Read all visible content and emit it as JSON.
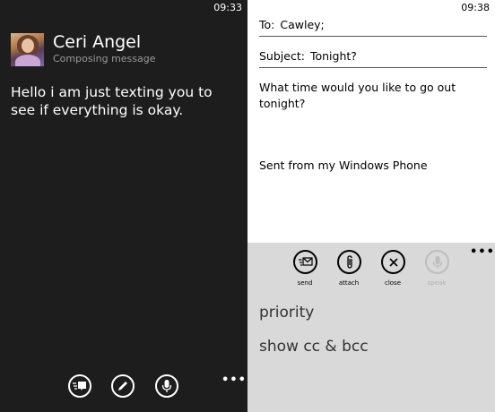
{
  "left_phone": {
    "status_time": "09:33",
    "contact": {
      "name": "Ceri Angel",
      "status": "Composing message"
    },
    "message": "Hello i am just texting you to see if everything is okay.",
    "appbar": {
      "icons": [
        "send-sms-icon",
        "edit-icon",
        "microphone-icon"
      ],
      "more": "•••"
    }
  },
  "right_phone": {
    "status_time": "09:38",
    "to": {
      "label": "To:",
      "value": "Cawley;"
    },
    "subject": {
      "label": "Subject:",
      "value": "Tonight?"
    },
    "body_line1": "What time would you like to go out tonight?",
    "signature": "Sent from my Windows Phone",
    "appbar": {
      "buttons": [
        {
          "label": "send",
          "icon": "send-mail-icon"
        },
        {
          "label": "attach",
          "icon": "paperclip-icon"
        },
        {
          "label": "close",
          "icon": "close-icon"
        },
        {
          "label": "speak",
          "icon": "microphone-icon",
          "disabled": true
        }
      ],
      "more": "•••"
    },
    "menu_items": [
      "priority",
      "show cc & bcc"
    ]
  }
}
